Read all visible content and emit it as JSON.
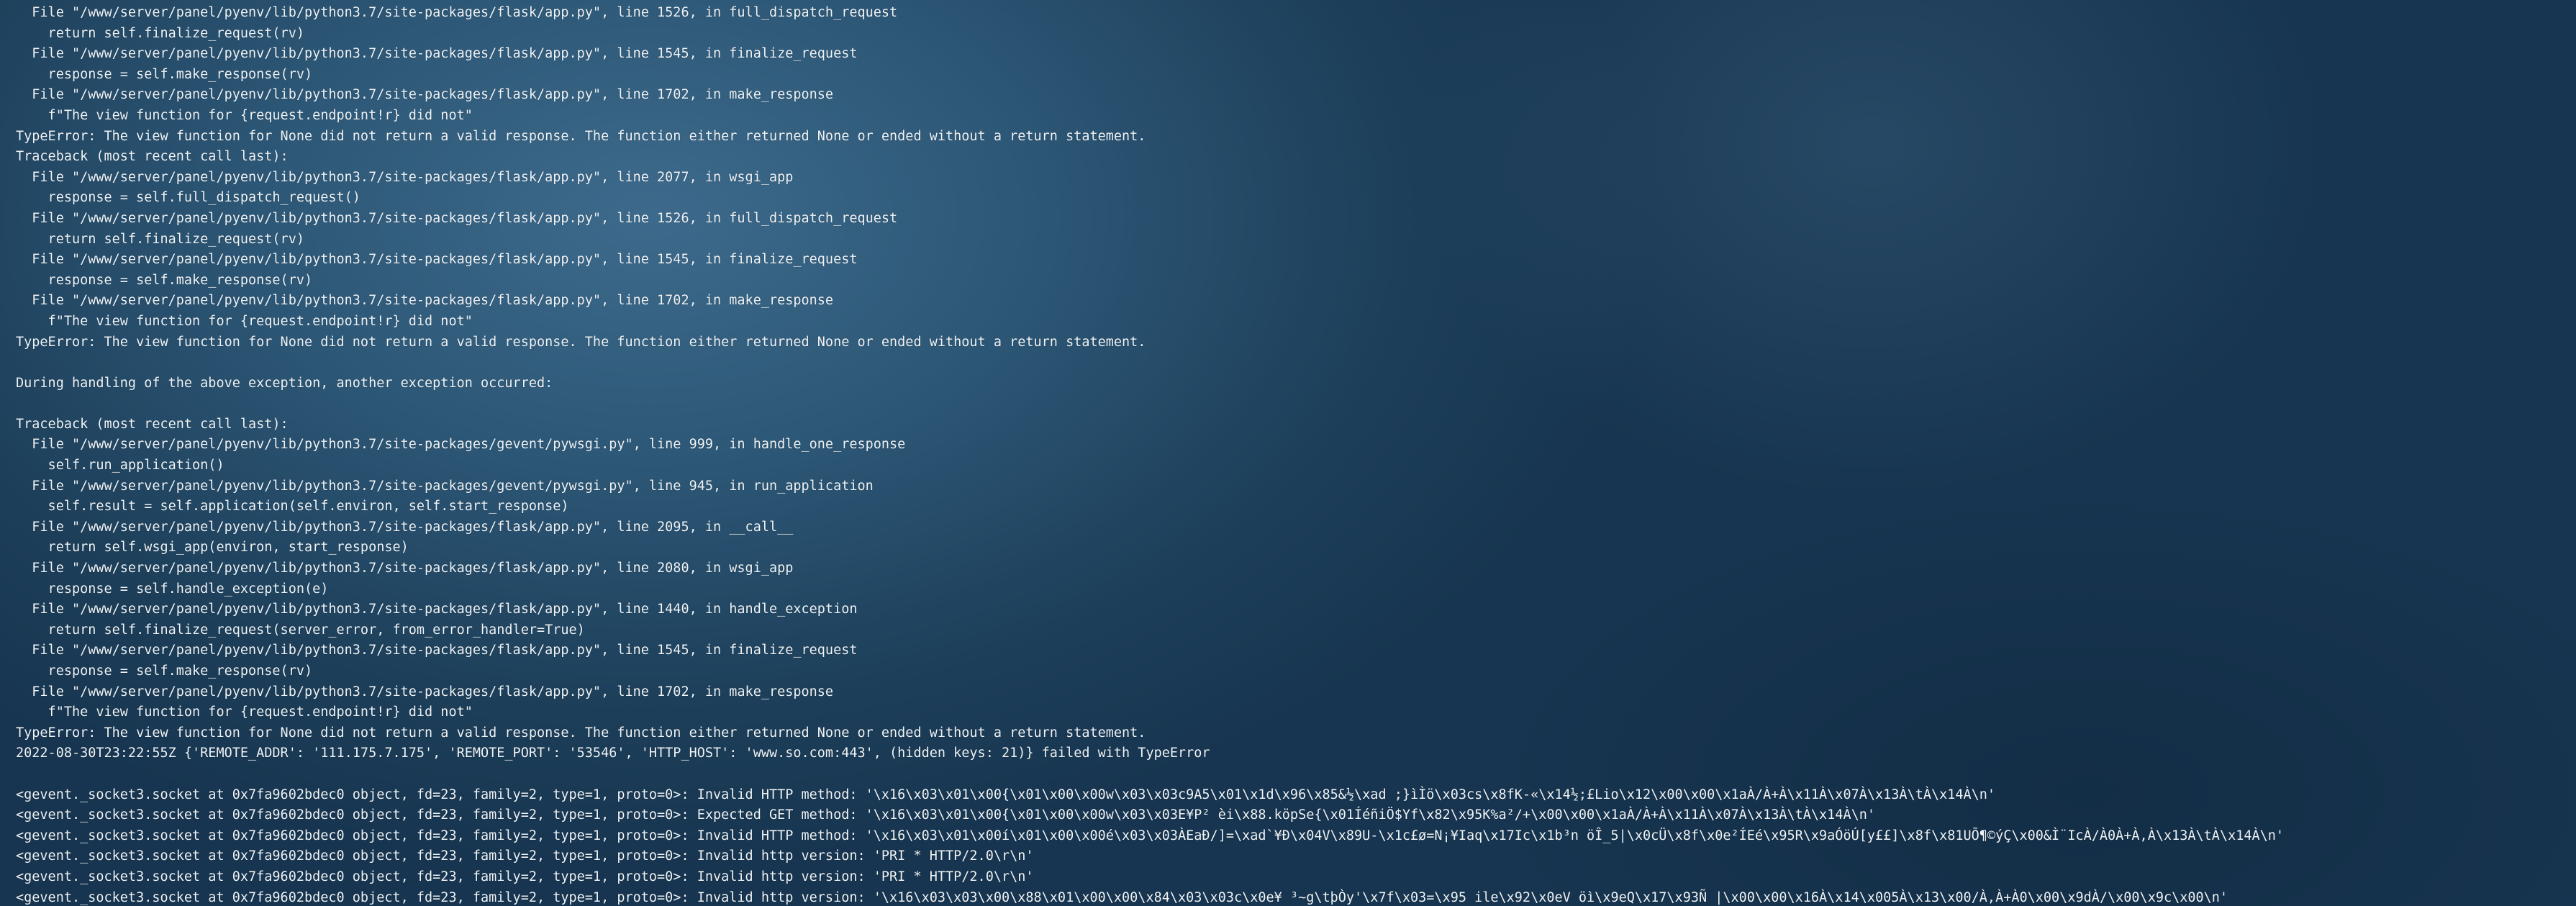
{
  "terminal": {
    "lines": [
      "  File \"/www/server/panel/pyenv/lib/python3.7/site-packages/flask/app.py\", line 1526, in full_dispatch_request",
      "    return self.finalize_request(rv)",
      "  File \"/www/server/panel/pyenv/lib/python3.7/site-packages/flask/app.py\", line 1545, in finalize_request",
      "    response = self.make_response(rv)",
      "  File \"/www/server/panel/pyenv/lib/python3.7/site-packages/flask/app.py\", line 1702, in make_response",
      "    f\"The view function for {request.endpoint!r} did not\"",
      "TypeError: The view function for None did not return a valid response. The function either returned None or ended without a return statement.",
      "Traceback (most recent call last):",
      "  File \"/www/server/panel/pyenv/lib/python3.7/site-packages/flask/app.py\", line 2077, in wsgi_app",
      "    response = self.full_dispatch_request()",
      "  File \"/www/server/panel/pyenv/lib/python3.7/site-packages/flask/app.py\", line 1526, in full_dispatch_request",
      "    return self.finalize_request(rv)",
      "  File \"/www/server/panel/pyenv/lib/python3.7/site-packages/flask/app.py\", line 1545, in finalize_request",
      "    response = self.make_response(rv)",
      "  File \"/www/server/panel/pyenv/lib/python3.7/site-packages/flask/app.py\", line 1702, in make_response",
      "    f\"The view function for {request.endpoint!r} did not\"",
      "TypeError: The view function for None did not return a valid response. The function either returned None or ended without a return statement.",
      "",
      "During handling of the above exception, another exception occurred:",
      "",
      "Traceback (most recent call last):",
      "  File \"/www/server/panel/pyenv/lib/python3.7/site-packages/gevent/pywsgi.py\", line 999, in handle_one_response",
      "    self.run_application()",
      "  File \"/www/server/panel/pyenv/lib/python3.7/site-packages/gevent/pywsgi.py\", line 945, in run_application",
      "    self.result = self.application(self.environ, self.start_response)",
      "  File \"/www/server/panel/pyenv/lib/python3.7/site-packages/flask/app.py\", line 2095, in __call__",
      "    return self.wsgi_app(environ, start_response)",
      "  File \"/www/server/panel/pyenv/lib/python3.7/site-packages/flask/app.py\", line 2080, in wsgi_app",
      "    response = self.handle_exception(e)",
      "  File \"/www/server/panel/pyenv/lib/python3.7/site-packages/flask/app.py\", line 1440, in handle_exception",
      "    return self.finalize_request(server_error, from_error_handler=True)",
      "  File \"/www/server/panel/pyenv/lib/python3.7/site-packages/flask/app.py\", line 1545, in finalize_request",
      "    response = self.make_response(rv)",
      "  File \"/www/server/panel/pyenv/lib/python3.7/site-packages/flask/app.py\", line 1702, in make_response",
      "    f\"The view function for {request.endpoint!r} did not\"",
      "TypeError: The view function for None did not return a valid response. The function either returned None or ended without a return statement.",
      "2022-08-30T23:22:55Z {'REMOTE_ADDR': '111.175.7.175', 'REMOTE_PORT': '53546', 'HTTP_HOST': 'www.so.com:443', (hidden keys: 21)} failed with TypeError",
      "",
      "<gevent._socket3.socket at 0x7fa9602bdec0 object, fd=23, family=2, type=1, proto=0>: Invalid HTTP method: '\\x16\\x03\\x01\\x00{\\x01\\x00\\x00w\\x03\\x03c9A5\\x01\\x1d\\x96\\x85&½\\xad ;}ìÌö\\x03cs\\x8fK-«\\x14½;£Lio\\x12\\x00\\x00\\x1aÀ/À+À\\x11À\\x07À\\x13À\\tÀ\\x14À\\n'",
      "<gevent._socket3.socket at 0x7fa9602bdec0 object, fd=23, family=2, type=1, proto=0>: Expected GET method: '\\x16\\x03\\x01\\x00{\\x01\\x00\\x00w\\x03\\x03E¥P² èi\\x88.köpSe{\\x01ÍéñiÖ$Yf\\x82\\x95K%a²/+\\x00\\x00\\x1aÀ/À+À\\x11À\\x07À\\x13À\\tÀ\\x14À\\n'",
      "<gevent._socket3.socket at 0x7fa9602bdec0 object, fd=23, family=2, type=1, proto=0>: Invalid HTTP method: '\\x16\\x03\\x01\\x00í\\x01\\x00\\x00é\\x03\\x03ÀEaÐ/]=\\xad`¥Ð\\x04V\\x89U-\\x1c£ø=N¡¥Iaq\\x17Ic\\x1b³n öÎ_5|\\x0cÜ\\x8f\\x0e²ÍEé\\x95R\\x9aÓöÚ[y££]\\x8f\\x81UÕ¶©ýÇ\\x00&Ì¨IcÀ/À0À+À,À\\x13À\\tÀ\\x14À\\n'",
      "<gevent._socket3.socket at 0x7fa9602bdec0 object, fd=23, family=2, type=1, proto=0>: Invalid http version: 'PRI * HTTP/2.0\\r\\n'",
      "<gevent._socket3.socket at 0x7fa9602bdec0 object, fd=23, family=2, type=1, proto=0>: Invalid http version: 'PRI * HTTP/2.0\\r\\n'",
      "<gevent._socket3.socket at 0x7fa9602bdec0 object, fd=23, family=2, type=1, proto=0>: Invalid http version: '\\x16\\x03\\x03\\x00\\x88\\x01\\x00\\x00\\x84\\x03\\x03c\\x0e¥ ³~g\\tþÒy'\\x7f\\x03=\\x95 ile\\x92\\x0eV öì\\x9eQ\\x17\\x93Ñ |\\x00\\x00\\x16À\\x14\\x005À\\x13\\x00/À,À+À0\\x00\\x9dÀ/\\x00\\x9c\\x00\\n'"
    ]
  }
}
